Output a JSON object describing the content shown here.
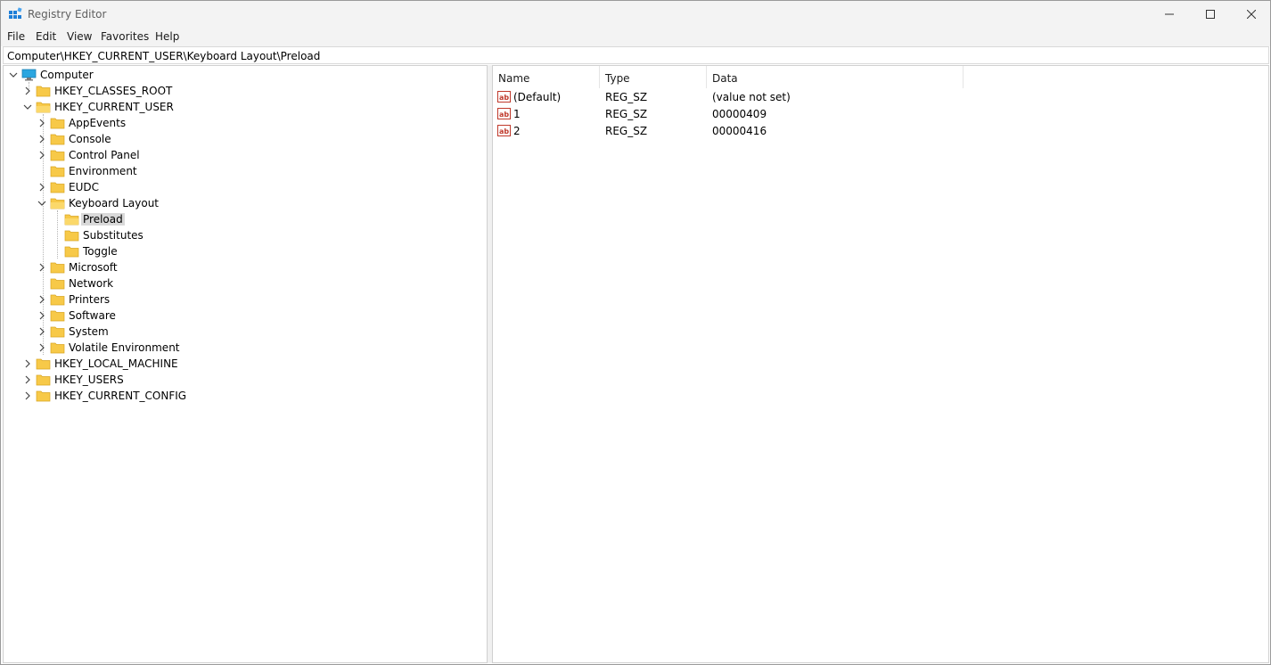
{
  "window": {
    "title": "Registry Editor",
    "colors": {
      "titlebar": "#f3f3f3",
      "folder": "#f7c948",
      "selected": "#d9d9d9"
    }
  },
  "menu": {
    "items": [
      "File",
      "Edit",
      "View",
      "Favorites",
      "Help"
    ]
  },
  "address": {
    "path": "Computer\\HKEY_CURRENT_USER\\Keyboard Layout\\Preload"
  },
  "tree": {
    "root": "Computer",
    "items": [
      {
        "label": "HKEY_CLASSES_ROOT",
        "level": 1,
        "state": "collapsed"
      },
      {
        "label": "HKEY_CURRENT_USER",
        "level": 1,
        "state": "expanded"
      },
      {
        "label": "AppEvents",
        "level": 2,
        "state": "collapsed"
      },
      {
        "label": "Console",
        "level": 2,
        "state": "collapsed"
      },
      {
        "label": "Control Panel",
        "level": 2,
        "state": "collapsed"
      },
      {
        "label": "Environment",
        "level": 2,
        "state": "leaf"
      },
      {
        "label": "EUDC",
        "level": 2,
        "state": "collapsed"
      },
      {
        "label": "Keyboard Layout",
        "level": 2,
        "state": "expanded"
      },
      {
        "label": "Preload",
        "level": 3,
        "state": "leaf",
        "selected": true
      },
      {
        "label": "Substitutes",
        "level": 3,
        "state": "leaf"
      },
      {
        "label": "Toggle",
        "level": 3,
        "state": "leaf"
      },
      {
        "label": "Microsoft",
        "level": 2,
        "state": "collapsed"
      },
      {
        "label": "Network",
        "level": 2,
        "state": "leaf"
      },
      {
        "label": "Printers",
        "level": 2,
        "state": "collapsed"
      },
      {
        "label": "Software",
        "level": 2,
        "state": "collapsed"
      },
      {
        "label": "System",
        "level": 2,
        "state": "collapsed"
      },
      {
        "label": "Volatile Environment",
        "level": 2,
        "state": "collapsed"
      },
      {
        "label": "HKEY_LOCAL_MACHINE",
        "level": 1,
        "state": "collapsed"
      },
      {
        "label": "HKEY_USERS",
        "level": 1,
        "state": "collapsed"
      },
      {
        "label": "HKEY_CURRENT_CONFIG",
        "level": 1,
        "state": "collapsed"
      }
    ]
  },
  "values": {
    "columns": [
      "Name",
      "Type",
      "Data"
    ],
    "rows": [
      {
        "name": "(Default)",
        "type": "REG_SZ",
        "data": "(value not set)"
      },
      {
        "name": "1",
        "type": "REG_SZ",
        "data": "00000409"
      },
      {
        "name": "2",
        "type": "REG_SZ",
        "data": "00000416"
      }
    ]
  }
}
